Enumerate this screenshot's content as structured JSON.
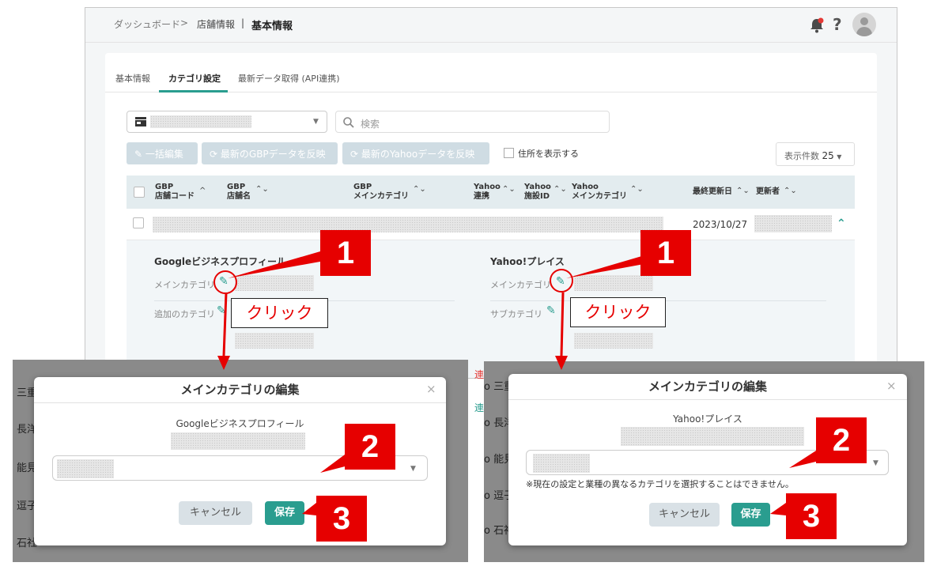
{
  "breadcrumb": {
    "home": "ダッシュボード",
    "sep": ">",
    "parent": "店舗情報",
    "pipe": "|",
    "current": "基本情報"
  },
  "header": {
    "help": "?"
  },
  "tabs": [
    "基本情報",
    "カテゴリ設定",
    "最新データ取得 (API連携)"
  ],
  "toolbar": {
    "search_placeholder": "検索",
    "bulk_edit": "一括編集",
    "reflect_gbp": "最新のGBPデータを反映",
    "reflect_yahoo": "最新のYahooデータを反映",
    "show_address": "住所を表示する",
    "per_page_label": "表示件数",
    "per_page_value": "25"
  },
  "table": {
    "columns": [
      [
        "GBP",
        "店舗コード"
      ],
      [
        "GBP",
        "店舗名"
      ],
      [
        "GBP",
        "メインカテゴリ"
      ],
      [
        "Yahoo",
        "連携"
      ],
      [
        "Yahoo",
        "施設ID"
      ],
      [
        "Yahoo",
        "メインカテゴリ"
      ],
      [
        "最終更新日",
        ""
      ],
      [
        "更新者",
        ""
      ]
    ],
    "row_date": "2023/10/27"
  },
  "detail": {
    "gbp_title": "Googleビジネスプロフィール",
    "yahoo_title": "Yahoo!プレイス",
    "main_category": "メインカテゴリ",
    "additional_category": "追加のカテゴリ",
    "sub_category": "サブカテゴリ"
  },
  "annotations": {
    "step1": "1",
    "step2": "2",
    "step3": "3",
    "click": "クリック"
  },
  "modal_left": {
    "title": "メインカテゴリの編集",
    "subtitle": "Googleビジネスプロフィール",
    "cancel": "キャンセル",
    "save": "保存",
    "close": "×",
    "bg_rows": [
      "三重",
      "長洋",
      "能見",
      "逗子",
      "石社"
    ]
  },
  "modal_right": {
    "title": "メインカテゴリの編集",
    "subtitle": "Yahoo!プレイス",
    "note": "※現在の設定と業種の異なるカテゴリを選択することはできません。",
    "cancel": "キャンセル",
    "save": "保存",
    "close": "×",
    "bg_rows": [
      "o 三重",
      "o 長洋",
      "o 能見",
      "o 逗子",
      "o 石神"
    ],
    "bg_left_text": [
      "連",
      "連"
    ]
  },
  "colors": {
    "accent": "#2a9d8f",
    "annotation_red": "#e60000"
  }
}
